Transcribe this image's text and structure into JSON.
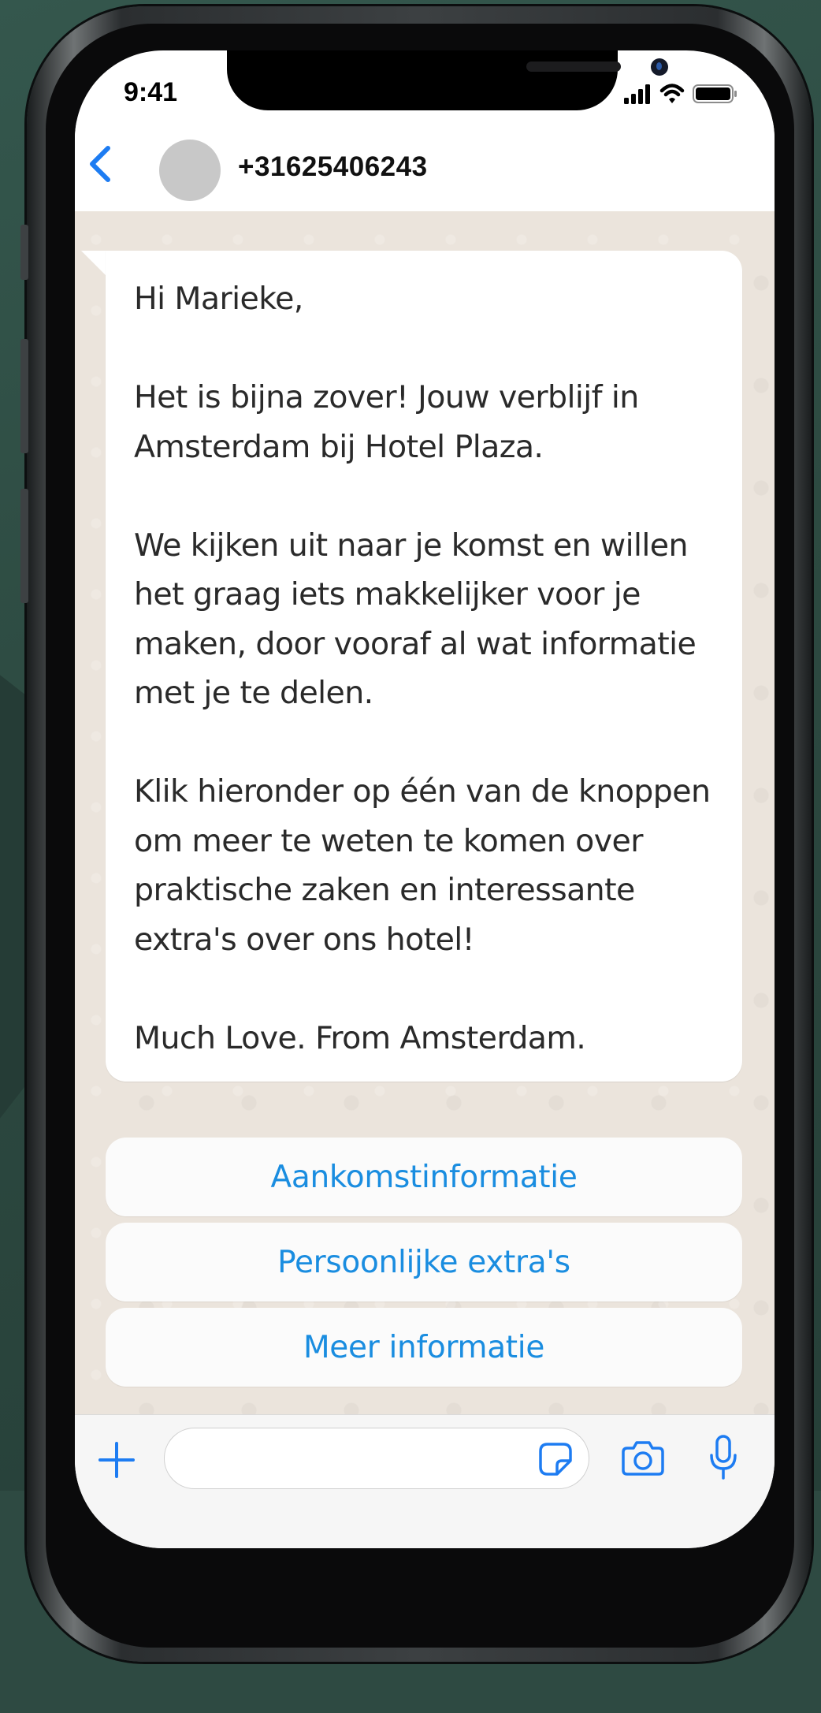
{
  "status_bar": {
    "time": "9:41",
    "icons": [
      "cellular-signal-icon",
      "wifi-icon",
      "battery-icon"
    ]
  },
  "header": {
    "back_icon": "chevron-left-icon",
    "avatar": "avatar-placeholder",
    "contact_name": "+31625406243"
  },
  "chat": {
    "message": {
      "text": "Hi Marieke,\n\nHet is bijna zover! Jouw verblijf in Amsterdam bij Hotel Plaza.\n\nWe kijken uit naar je komst en willen het graag iets makkelijker voor je maken, door vooraf al wat informatie met je te delen.\n\nKlik hieronder op één van de knoppen om meer te weten te komen over praktische zaken en interessante extra's over ons hotel!\n\nMuch Love. From Amsterdam."
    },
    "quick_replies": [
      {
        "label": "Aankomstinformatie"
      },
      {
        "label": "Persoonlijke extra's"
      },
      {
        "label": "Meer informatie"
      }
    ]
  },
  "input_bar": {
    "plus_icon": "plus-icon",
    "placeholder": "",
    "sticker_icon": "sticker-icon",
    "camera_icon": "camera-icon",
    "mic_icon": "microphone-icon"
  },
  "colors": {
    "accent": "#1a8de0",
    "chat_background": "#ebe4dc",
    "bubble": "#ffffff",
    "ios_blue": "#1d7cf2"
  }
}
